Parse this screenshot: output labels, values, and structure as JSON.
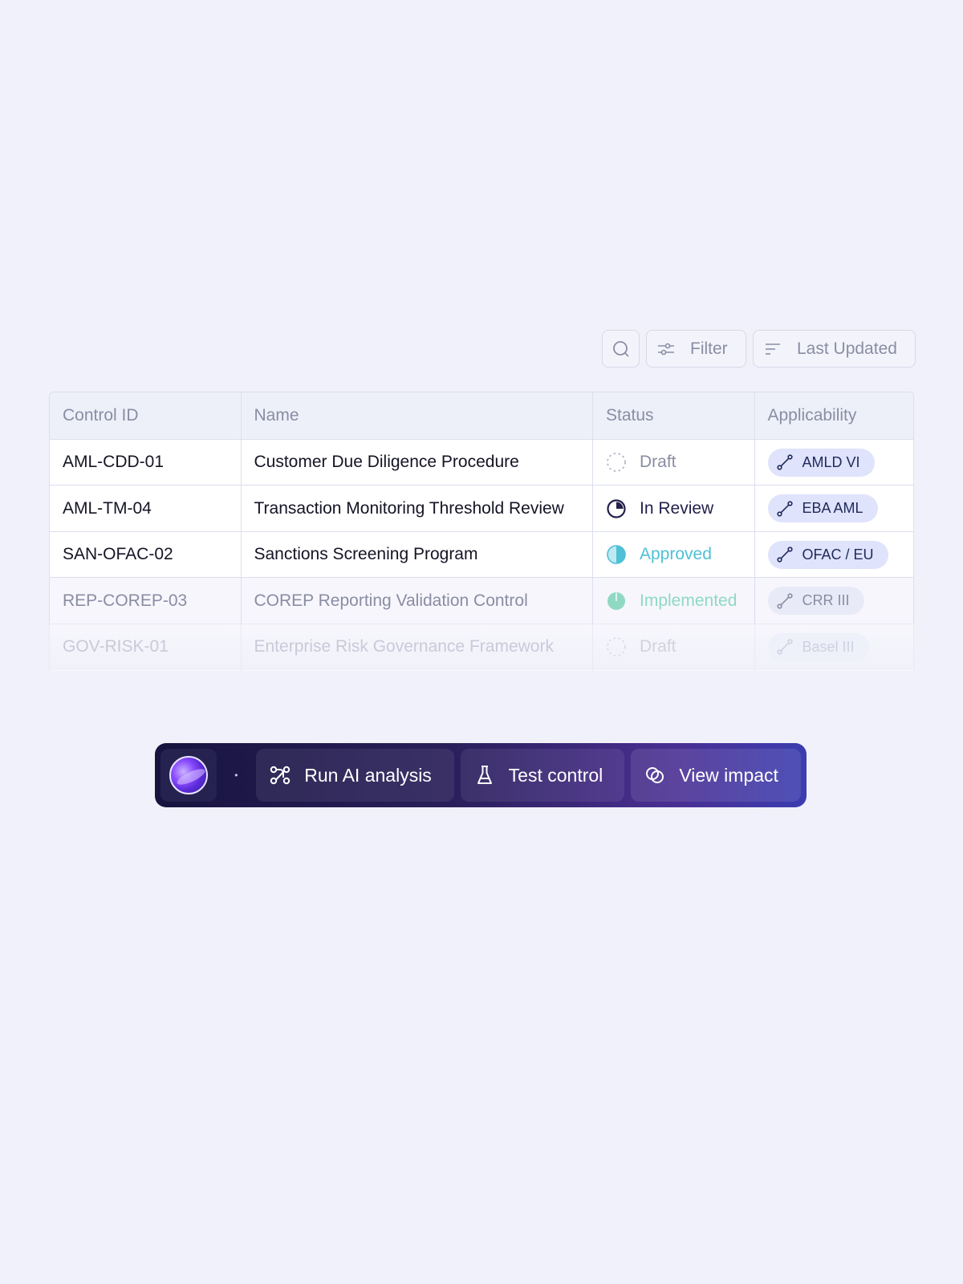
{
  "toolbar": {
    "search_icon": "search-icon",
    "filter_label": "Filter",
    "sort_label": "Last Updated"
  },
  "table": {
    "columns": [
      "Control ID",
      "Name",
      "Status",
      "Applicability"
    ],
    "rows": [
      {
        "id": "AML-CDD-01",
        "name": "Customer Due Diligence Procedure",
        "status": "Draft",
        "applicability": "AMLD VI"
      },
      {
        "id": "AML-TM-04",
        "name": "Transaction Monitoring Threshold Review",
        "status": "In Review",
        "applicability": "EBA AML"
      },
      {
        "id": "SAN-OFAC-02",
        "name": "Sanctions Screening Program",
        "status": "Approved",
        "applicability": "OFAC / EU"
      },
      {
        "id": "REP-COREP-03",
        "name": "COREP Reporting Validation Control",
        "status": "Implemented",
        "applicability": "CRR III"
      },
      {
        "id": "GOV-RISK-01",
        "name": "Enterprise Risk Governance Framework",
        "status": "Draft",
        "applicability": "Basel III"
      }
    ]
  },
  "action_bar": {
    "separator": "•",
    "run_label": "Run AI analysis",
    "test_label": "Test control",
    "view_label": "View impact"
  },
  "colors": {
    "background": "#f0f1fa",
    "approved": "#4fc0d6",
    "implemented": "#8fd9c2",
    "in_review": "#24204d",
    "pill": "#dfe3fb",
    "action_bar_start": "#17143f",
    "action_bar_end": "#3b3db0"
  }
}
